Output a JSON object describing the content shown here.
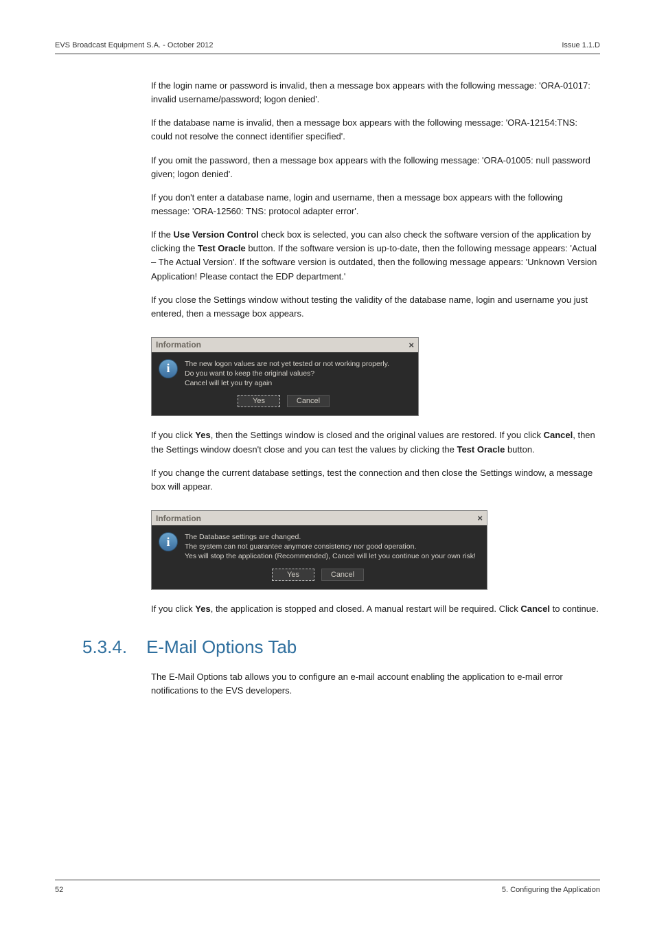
{
  "header": {
    "left": "EVS Broadcast Equipment S.A.  - October 2012",
    "right": "Issue 1.1.D"
  },
  "paras": {
    "p1": "If the login name or password is invalid, then a message box appears with the following message: 'ORA-01017: invalid username/password; logon denied'.",
    "p2": "If the database name is invalid, then a message box appears with the following message: 'ORA-12154:TNS: could not resolve the connect identifier specified'.",
    "p3": "If you omit the password, then a message box appears with the following message: 'ORA-01005: null password given; logon denied'.",
    "p4": "If you don't enter a database name, login and username, then a message box appears with the following message: 'ORA-12560: TNS: protocol adapter error'.",
    "p5a": "If the ",
    "p5b": "Use Version Control",
    "p5c": " check box is selected, you can also check the software version of the application by clicking the ",
    "p5d": "Test Oracle",
    "p5e": " button. If the software version is up-to-date, then the following message appears: 'Actual – The Actual Version'. If the software version is outdated, then the following message appears: 'Unknown Version Application! Please contact the EDP department.'",
    "p6": "If you close the Settings window without testing the validity of the database name, login and username you just entered, then a message box appears.",
    "p7a": "If you click ",
    "p7b": "Yes",
    "p7c": ", then the Settings window is closed and the original values are restored. If you click ",
    "p7d": "Cancel",
    "p7e": ", then the Settings window doesn't close and you can test the values by clicking the ",
    "p7f": "Test Oracle",
    "p7g": " button.",
    "p8": "If you change the current database settings, test the connection and then close the Settings window, a message box will appear.",
    "p9a": "If you click ",
    "p9b": "Yes",
    "p9c": ", the application is stopped and closed. A manual restart will be required. Click ",
    "p9d": "Cancel",
    "p9e": " to continue."
  },
  "dialog1": {
    "title": "Information",
    "close": "×",
    "text": "The new logon values are not yet tested or not working properly.\nDo you want to keep the original values?\nCancel will let you try again",
    "yes": "Yes",
    "cancel": "Cancel"
  },
  "dialog2": {
    "title": "Information",
    "close": "×",
    "text": "The Database settings are changed.\nThe system can not guarantee anymore consistency nor good operation.\nYes will stop the application (Recommended), Cancel will let you continue on your own risk!",
    "yes": "Yes",
    "cancel": "Cancel"
  },
  "section": {
    "num": "5.3.4.",
    "title": "E-Mail Options Tab"
  },
  "section_para": "The E-Mail Options tab allows you to configure an e-mail account enabling the application to e-mail error notifications to the EVS developers.",
  "footer": {
    "page": "52",
    "right": "5. Configuring the Application"
  }
}
